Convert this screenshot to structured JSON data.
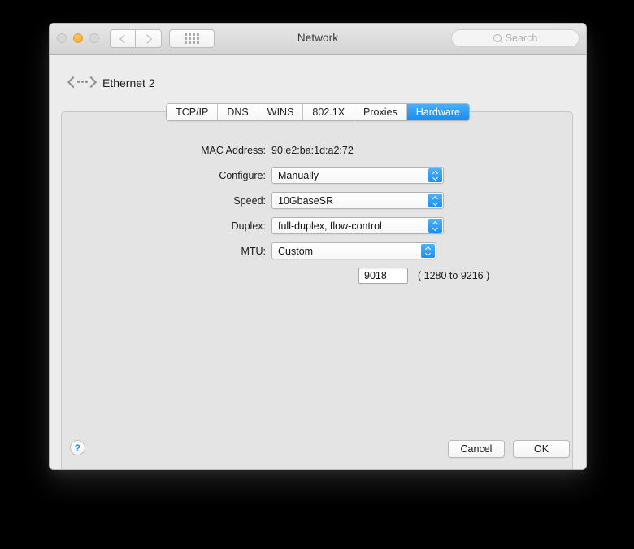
{
  "window": {
    "title": "Network",
    "traffic_lights": [
      {
        "name": "close",
        "state": "inactive"
      },
      {
        "name": "minimize",
        "state": "amber"
      },
      {
        "name": "zoom",
        "state": "inactive"
      }
    ],
    "toolbar": {
      "back_icon": "chevron-left-icon",
      "forward_icon": "chevron-right-icon",
      "show_all_icon": "grid-dots-icon"
    },
    "search": {
      "placeholder": "Search",
      "value": "",
      "icon": "search-icon"
    }
  },
  "interface": {
    "icon": "ethernet-icon",
    "name": "Ethernet 2"
  },
  "tabs": [
    {
      "label": "TCP/IP",
      "selected": false
    },
    {
      "label": "DNS",
      "selected": false
    },
    {
      "label": "WINS",
      "selected": false
    },
    {
      "label": "802.1X",
      "selected": false
    },
    {
      "label": "Proxies",
      "selected": false
    },
    {
      "label": "Hardware",
      "selected": true
    }
  ],
  "hardware": {
    "mac_address": {
      "label": "MAC Address:",
      "value": "90:e2:ba:1d:a2:72"
    },
    "configure": {
      "label": "Configure:",
      "value": "Manually"
    },
    "speed": {
      "label": "Speed:",
      "value": "10GbaseSR"
    },
    "duplex": {
      "label": "Duplex:",
      "value": "full-duplex, flow-control"
    },
    "mtu": {
      "label": "MTU:",
      "value": "Custom"
    },
    "mtu_value": {
      "value": "9018",
      "hint": "( 1280 to 9216 )"
    }
  },
  "footer": {
    "help_label": "?",
    "cancel_label": "Cancel",
    "ok_label": "OK"
  },
  "colors": {
    "accent_blue": "#1a8cf0",
    "amber": "#f7b441",
    "window_bg": "#ececec",
    "panel_bg": "#e4e4e4"
  }
}
